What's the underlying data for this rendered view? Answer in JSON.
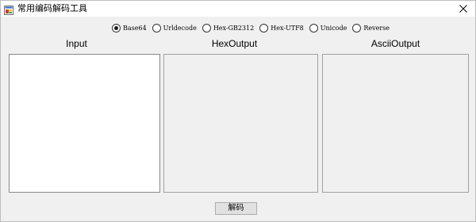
{
  "window": {
    "title": "常用编码解码工具"
  },
  "encoding_options": [
    {
      "label": "Base64",
      "checked": true
    },
    {
      "label": "Urldecode",
      "checked": false
    },
    {
      "label": "Hex-GB2312",
      "checked": false
    },
    {
      "label": "Hex-UTF8",
      "checked": false
    },
    {
      "label": "Unicode",
      "checked": false
    },
    {
      "label": "Reverse",
      "checked": false
    }
  ],
  "columns": {
    "input_label": "Input",
    "hex_label": "HexOutput",
    "ascii_label": "AsciiOutput"
  },
  "fields": {
    "input_value": "",
    "hex_value": "",
    "ascii_value": ""
  },
  "actions": {
    "decode_label": "解码"
  },
  "colors": {
    "window_bg": "#f0f0f0",
    "titlebar_bg": "#ffffff",
    "input_bg": "#ffffff"
  }
}
